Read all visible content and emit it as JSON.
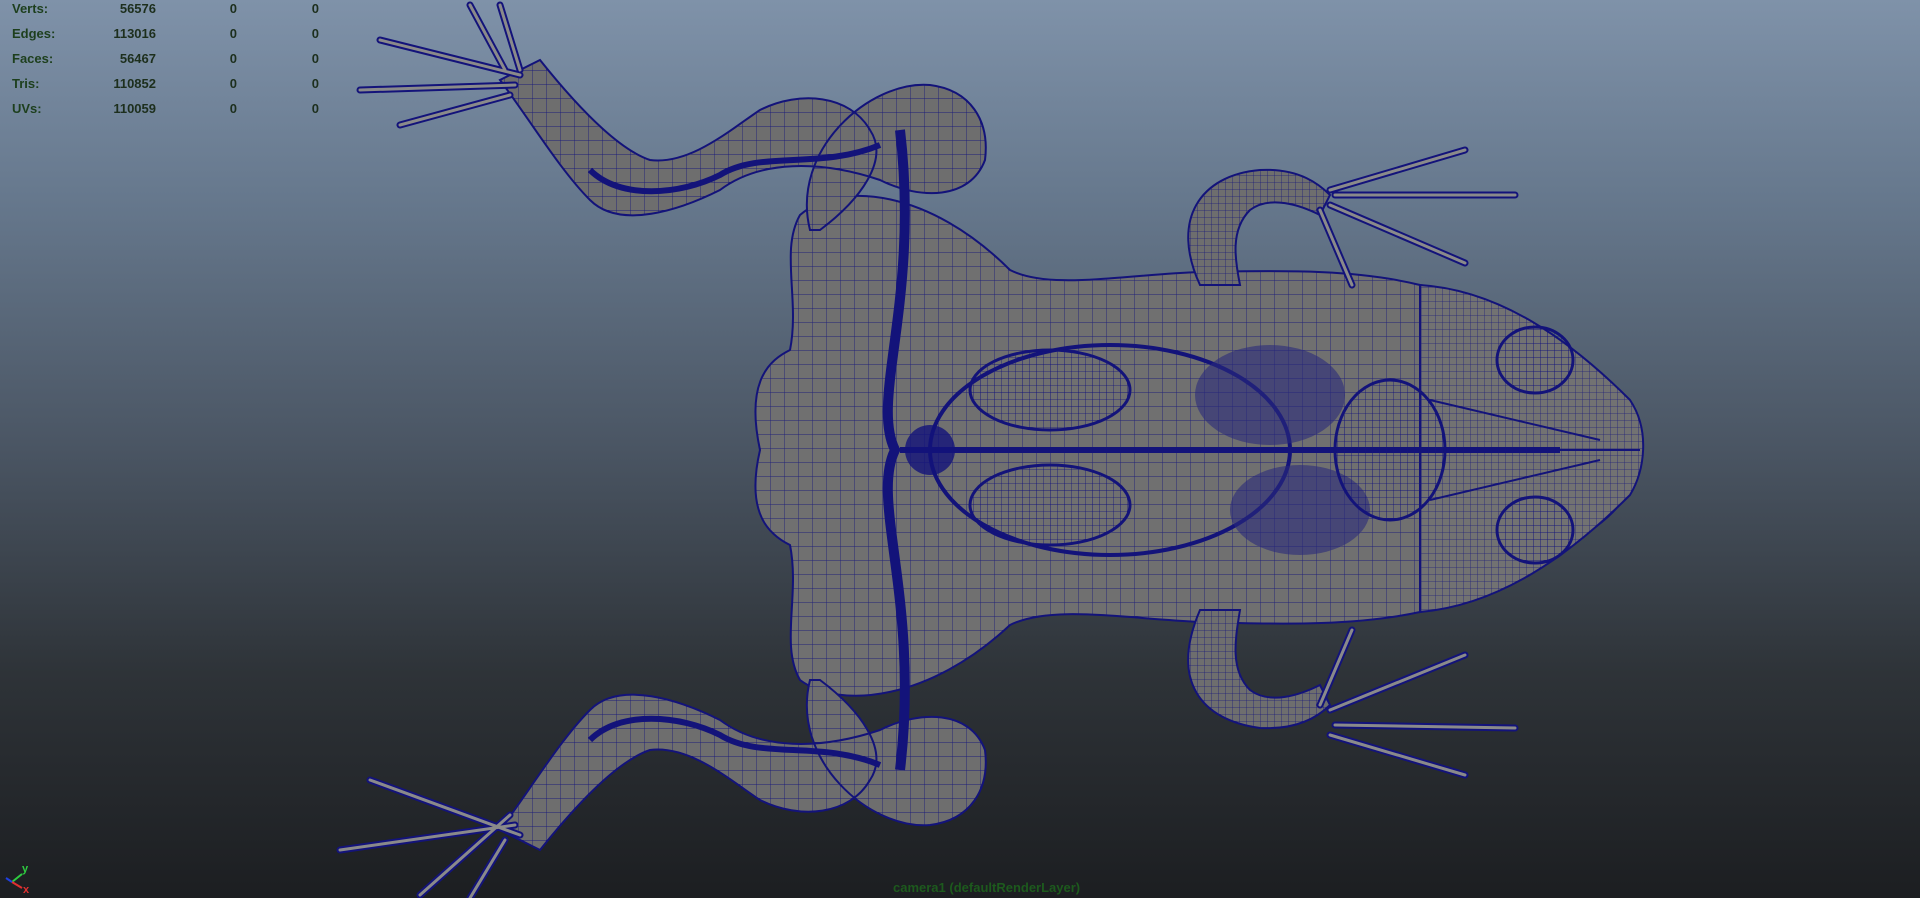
{
  "hud": {
    "rows": [
      {
        "label": "Verts:",
        "v1": "56576",
        "v2": "0",
        "v3": "0"
      },
      {
        "label": "Edges:",
        "v1": "113016",
        "v2": "0",
        "v3": "0"
      },
      {
        "label": "Faces:",
        "v1": "56467",
        "v2": "0",
        "v3": "0"
      },
      {
        "label": "Tris:",
        "v1": "110852",
        "v2": "0",
        "v3": "0"
      },
      {
        "label": "UVs:",
        "v1": "110059",
        "v2": "0",
        "v3": "0"
      }
    ]
  },
  "axis": {
    "y_label": "y",
    "x_label": "x",
    "y_color": "#2ecc40",
    "x_color": "#e03030",
    "z_color": "#2040e0"
  },
  "camera_label": "camera1 (defaultRenderLayer)",
  "colors": {
    "wireframe": "#13137a",
    "mesh_fill": "#6f6f6f"
  }
}
